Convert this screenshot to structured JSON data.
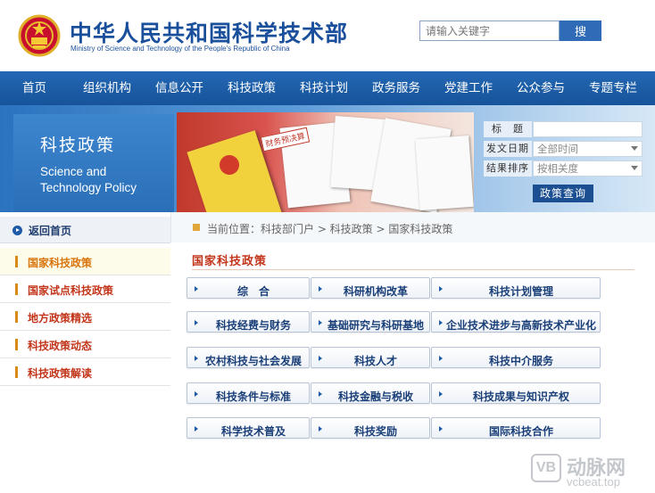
{
  "header": {
    "title": "中华人民共和国科学技术部",
    "subtitle": "Ministry of Science and Technology of the People's Republic of China",
    "search_placeholder": "请输入关键字",
    "search_button": "搜"
  },
  "nav": {
    "items": [
      "首页",
      "组织机构",
      "信息公开",
      "科技政策",
      "科技计划",
      "政务服务",
      "党建工作",
      "公众参与",
      "专题专栏"
    ]
  },
  "banner": {
    "title_cn": "科技政策",
    "title_en_line1": "Science and",
    "title_en_line2": "Technology Policy",
    "doc_label": "财务预决算"
  },
  "filter": {
    "rows": [
      {
        "label": "标　题",
        "value": ""
      },
      {
        "label": "发文日期",
        "value": "全部时间"
      },
      {
        "label": "结果排序",
        "value": "按相关度"
      }
    ],
    "button": "政策查询"
  },
  "sidebar": {
    "back_home": "返回首页",
    "items": [
      "国家科技政策",
      "国家试点科技政策",
      "地方政策精选",
      "科技政策动态",
      "科技政策解读"
    ]
  },
  "main": {
    "breadcrumb": "当前位置：科技部门户 > 科技政策 > 国家科技政策",
    "section_title": "国家科技政策",
    "categories": [
      [
        "综　合",
        "科研机构改革",
        "科技计划管理"
      ],
      [
        "科技经费与财务",
        "基础研究与科研基地",
        "企业技术进步与高新技术产业化"
      ],
      [
        "农村科技与社会发展",
        "科技人才",
        "科技中介服务"
      ],
      [
        "科技条件与标准",
        "科技金融与税收",
        "科技成果与知识产权"
      ],
      [
        "科学技术普及",
        "科技奖励",
        "国际科技合作"
      ]
    ]
  },
  "watermark": {
    "badge": "VB",
    "name_cn": "动脉网",
    "url": "vcbeat.top"
  },
  "colors": {
    "brand_blue": "#1a4f9c",
    "nav_blue": "#16539a",
    "accent_red": "#c2351a",
    "accent_orange": "#d9740b"
  }
}
